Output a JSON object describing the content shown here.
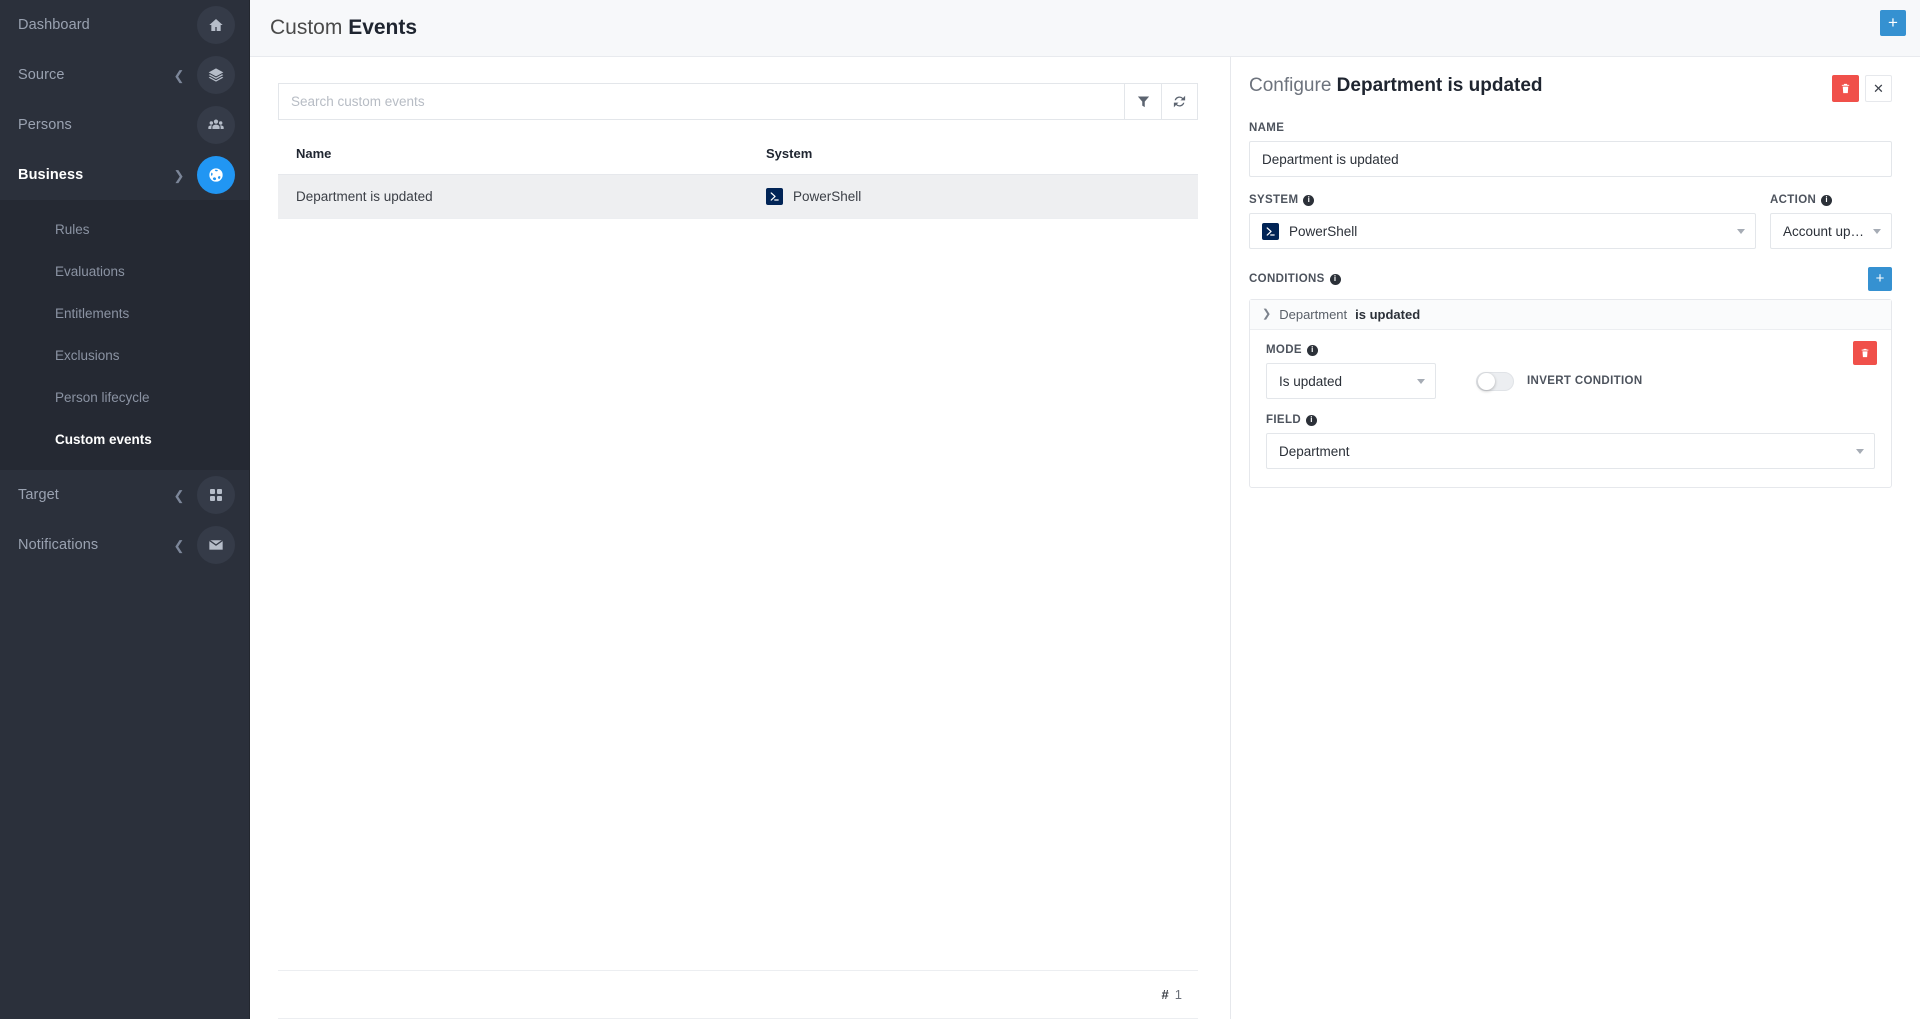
{
  "sidebar": {
    "items": [
      {
        "label": "Dashboard",
        "icon": "home-icon",
        "has_chevron": false,
        "active": false
      },
      {
        "label": "Source",
        "icon": "layers-icon",
        "has_chevron": true,
        "active": false
      },
      {
        "label": "Persons",
        "icon": "people-icon",
        "has_chevron": false,
        "active": false
      },
      {
        "label": "Business",
        "icon": "globe-icon",
        "has_chevron": true,
        "active": true
      }
    ],
    "submenu": [
      {
        "label": "Rules",
        "active": false
      },
      {
        "label": "Evaluations",
        "active": false
      },
      {
        "label": "Entitlements",
        "active": false
      },
      {
        "label": "Exclusions",
        "active": false
      },
      {
        "label": "Person lifecycle",
        "active": false
      },
      {
        "label": "Custom events",
        "active": true
      }
    ],
    "items_bottom": [
      {
        "label": "Target",
        "icon": "grid-icon",
        "has_chevron": true,
        "active": false
      },
      {
        "label": "Notifications",
        "icon": "envelope-icon",
        "has_chevron": true,
        "active": false
      }
    ]
  },
  "header": {
    "title_light": "Custom ",
    "title_bold": "Events",
    "add_button_label": "+"
  },
  "list": {
    "search_placeholder": "Search custom events",
    "search_value": "",
    "filter_icon": "filter-icon",
    "refresh_icon": "refresh-icon",
    "columns": [
      "Name",
      "System"
    ],
    "rows": [
      {
        "name": "Department is updated",
        "system": "PowerShell",
        "system_icon": "powershell-icon",
        "selected": true
      }
    ],
    "pager_hash": "#",
    "pager_count": "1"
  },
  "config": {
    "title_light": "Configure ",
    "title_bold": "Department is updated",
    "delete_icon": "trash-icon",
    "close_icon": "close-icon",
    "name_label": "NAME",
    "name_value": "Department is updated",
    "system_label": "SYSTEM",
    "system_value": "PowerShell",
    "system_icon": "powershell-icon",
    "action_label": "ACTION",
    "action_value": "Account update",
    "conditions_label": "CONDITIONS",
    "condition_add_label": "+",
    "conditions": [
      {
        "summary_field": "Department",
        "summary_state": "is updated",
        "mode_label": "MODE",
        "mode_value": "Is updated",
        "invert_label": "INVERT CONDITION",
        "invert_on": false,
        "field_label": "FIELD",
        "field_value": "Department",
        "delete_icon": "trash-icon"
      }
    ]
  },
  "colors": {
    "sidebar_bg": "#2b303b",
    "submenu_bg": "#252933",
    "accent_blue": "#2196f3",
    "button_blue": "#3591d1",
    "danger_red": "#f0504a",
    "powershell_navy": "#012456"
  }
}
